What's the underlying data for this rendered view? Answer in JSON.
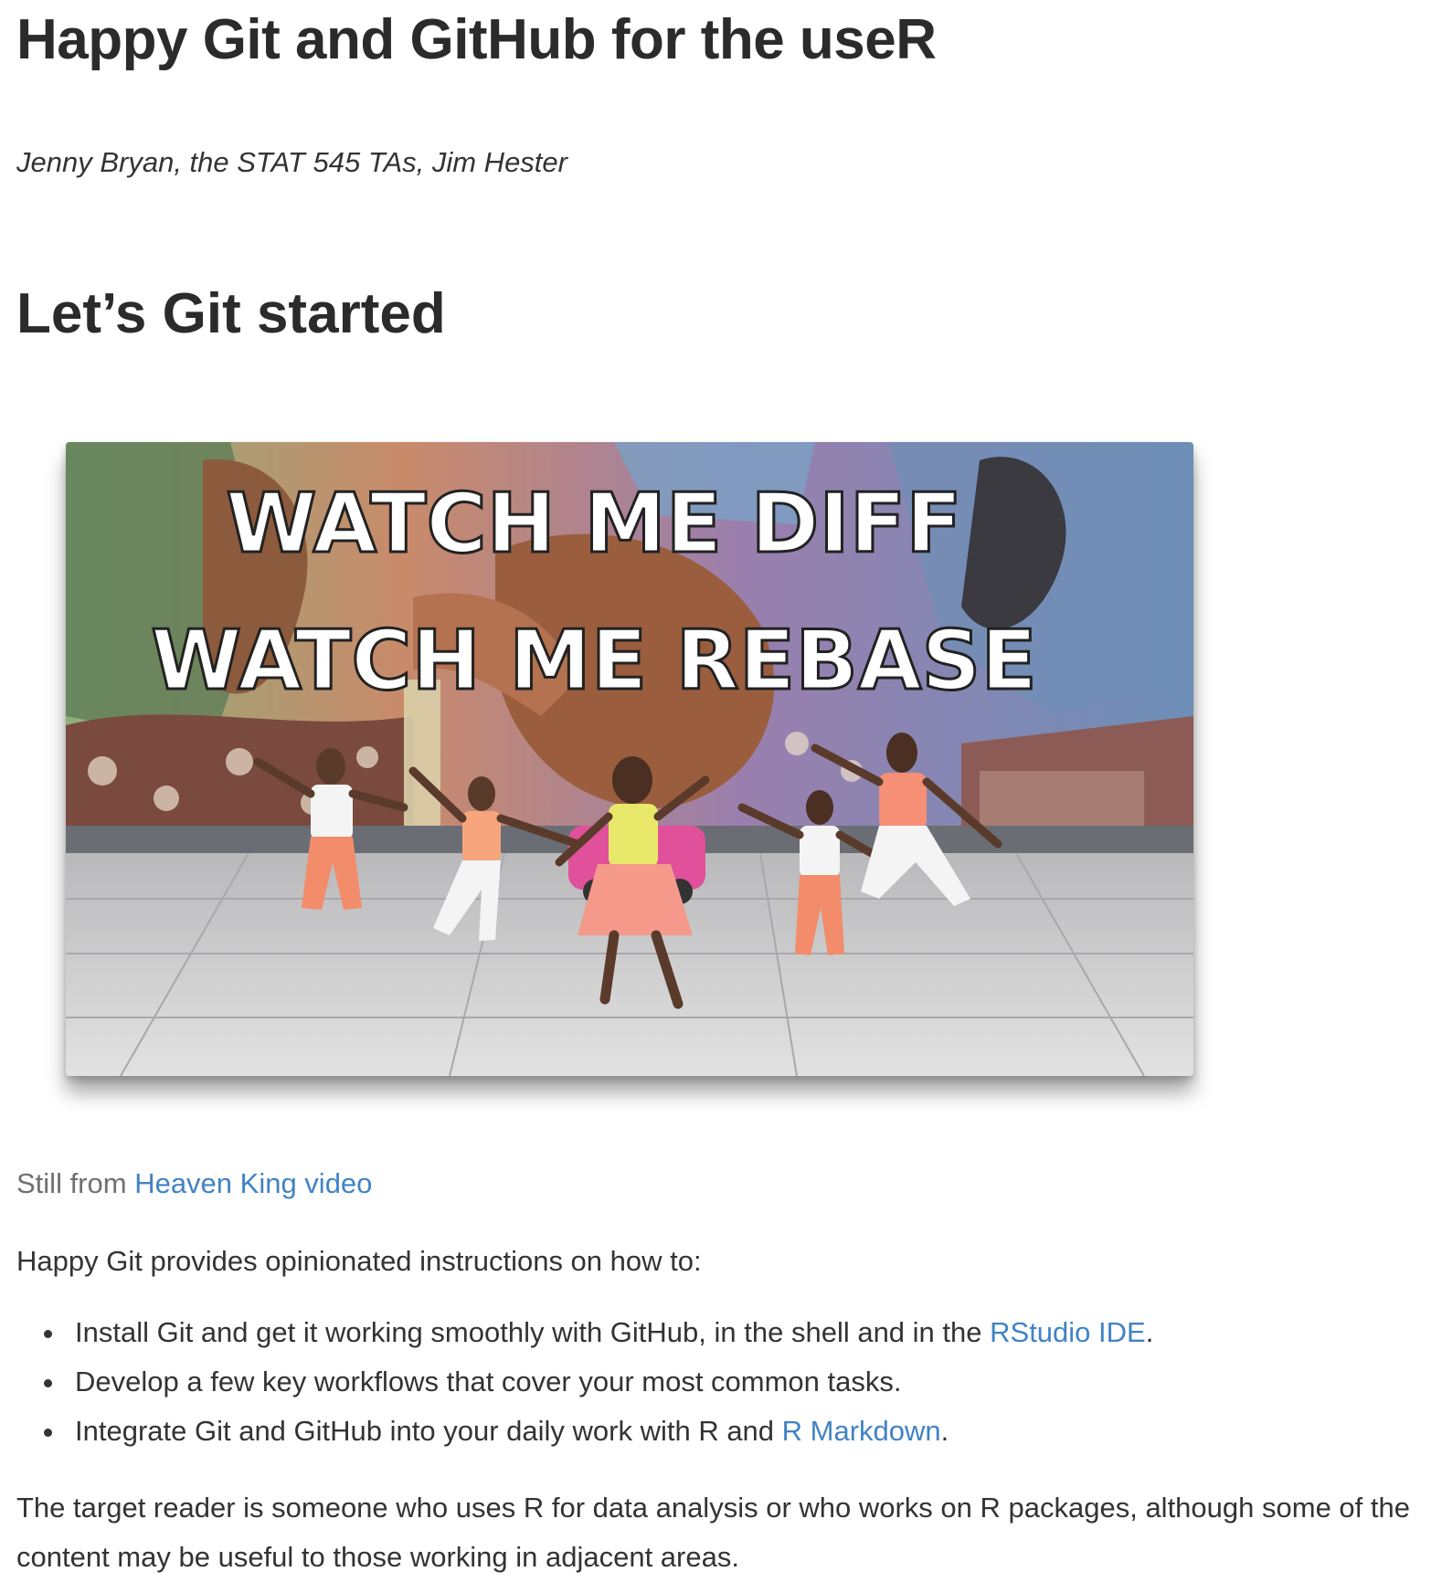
{
  "book": {
    "title": "Happy Git and GitHub for the useR",
    "authors": "Jenny Bryan, the STAT 545 TAs, Jim Hester"
  },
  "section": {
    "heading": "Let’s Git started"
  },
  "figure": {
    "overlay_line1": "WATCH ME DIFF",
    "overlay_line2": "WATCH ME REBASE"
  },
  "caption": {
    "prefix": "Still from ",
    "link_label": "Heaven King video"
  },
  "intro": "Happy Git provides opinionated instructions on how to:",
  "list": [
    {
      "text": "Install Git and get it working smoothly with GitHub, in the shell and in the ",
      "link": "RStudio IDE",
      "after": "."
    },
    {
      "text": "Develop a few key workflows that cover your most common tasks."
    },
    {
      "text": "Integrate Git and GitHub into your daily work with R and ",
      "link": "R Markdown",
      "after": "."
    }
  ],
  "target_reader": "The target reader is someone who uses R for data analysis or who works on R packages, although some of the content may be useful to those working in adjacent areas.",
  "colors": {
    "link": "#4183c4",
    "text": "#333333",
    "caption": "#707070"
  }
}
